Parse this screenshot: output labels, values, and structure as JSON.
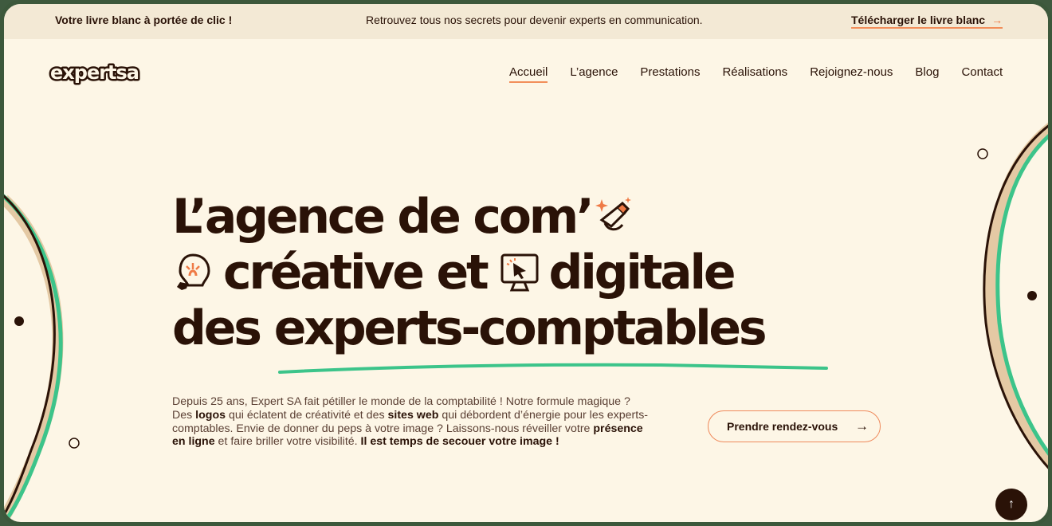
{
  "topbar": {
    "left_text": "Votre livre blanc à portée de clic !",
    "center_text": "Retrouvez tous nos secrets pour devenir experts en communication.",
    "download_label": "Télécharger le livre blanc",
    "download_arrow": "→"
  },
  "logo": {
    "text": "expertsa"
  },
  "nav": {
    "items": [
      {
        "label": "Accueil",
        "active": true
      },
      {
        "label": "L’agence"
      },
      {
        "label": "Prestations"
      },
      {
        "label": "Réalisations"
      },
      {
        "label": "Rejoignez-nous"
      },
      {
        "label": "Blog"
      },
      {
        "label": "Contact"
      }
    ]
  },
  "hero": {
    "line1": "L’agence de com’",
    "line2a": "créative et",
    "line2b": "digitale",
    "line3a": "des",
    "line3b": "experts-comptables",
    "icons": [
      "hand-pencil-sparkle-icon",
      "lightbulb-icon",
      "monitor-cursor-icon"
    ]
  },
  "intro": {
    "p1": "Depuis 25 ans, Expert SA fait pétiller le monde de la comptabilité ! Notre formule magique ? Des ",
    "b1": "logos",
    "p2": " qui éclatent de créativité et des ",
    "b2": "sites web",
    "p3": " qui débordent d’énergie pour les experts-comptables. Envie de donner du peps à votre image ? Laissons-nous réveiller votre ",
    "b3": "présence en ligne",
    "p4": " et faire briller votre visibilité. ",
    "b4": "Il est temps de secouer votre image !"
  },
  "cta": {
    "label": "Prendre rendez-vous",
    "arrow": "→"
  },
  "scroll_top": {
    "icon": "arrow-up-icon",
    "glyph": "↑"
  },
  "colors": {
    "background": "#fdf6e6",
    "topbar": "#f3e9d5",
    "text": "#2a1207",
    "accent_orange": "#ef7a45",
    "accent_green": "#3cc48a",
    "beige": "#e4c9a4",
    "frame": "#3c583b"
  }
}
